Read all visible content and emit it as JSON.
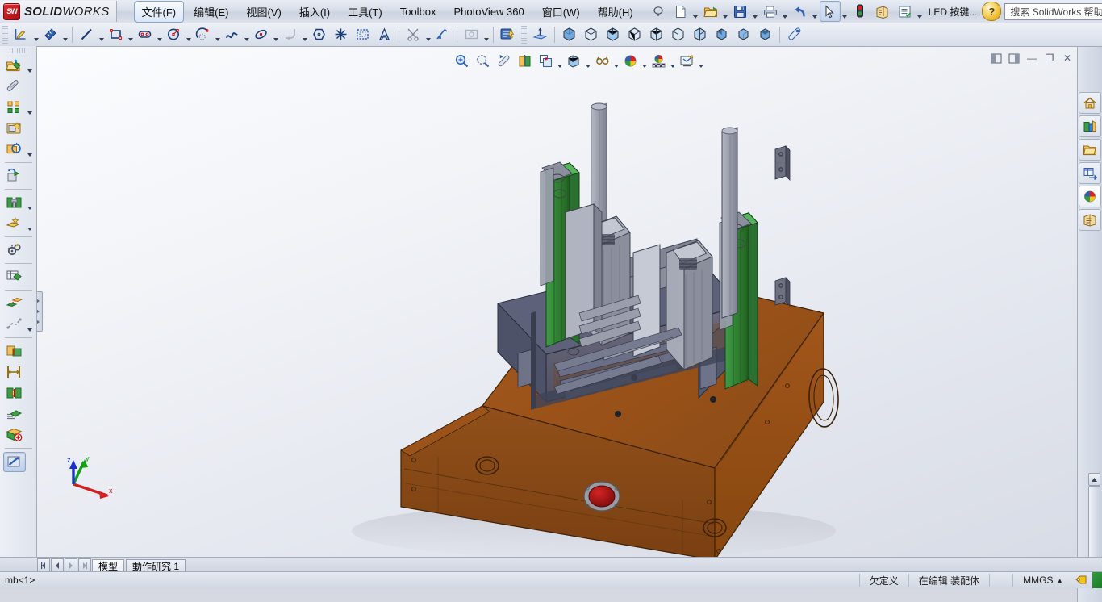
{
  "app": {
    "brand_s": "S",
    "brand_w": "W",
    "name_bold": "SOLID",
    "name_light": "WORKS"
  },
  "menu": {
    "items": [
      {
        "label": "文件(F)",
        "name": "menu-file",
        "active": true
      },
      {
        "label": "编辑(E)",
        "name": "menu-edit",
        "active": false
      },
      {
        "label": "视图(V)",
        "name": "menu-view",
        "active": false
      },
      {
        "label": "插入(I)",
        "name": "menu-insert",
        "active": false
      },
      {
        "label": "工具(T)",
        "name": "menu-tools",
        "active": false
      },
      {
        "label": "Toolbox",
        "name": "menu-toolbox",
        "active": false
      },
      {
        "label": "PhotoView 360",
        "name": "menu-photoview",
        "active": false
      },
      {
        "label": "窗口(W)",
        "name": "menu-window",
        "active": false
      },
      {
        "label": "帮助(H)",
        "name": "menu-help",
        "active": false
      }
    ]
  },
  "quick_toolbar": {
    "new_doc": "new-document",
    "open_doc": "open-document",
    "save": "save",
    "print": "print",
    "undo": "undo",
    "select": "select-arrow",
    "rebuild": "rebuild-traffic-light",
    "options": "options",
    "properties": "document-properties",
    "led_label": "LED 按键..."
  },
  "search": {
    "placeholder": "搜索 SolidWorks 帮助",
    "icon": "search-icon",
    "help_icon": "help-icon"
  },
  "window_controls": {
    "minimize": "—",
    "restore": "❐",
    "close": "✕",
    "help_caret": "?"
  },
  "sketch_toolbar": {
    "tools": [
      {
        "name": "sketch-tool",
        "caret": true
      },
      {
        "name": "smart-dimension-tool",
        "caret": true
      },
      {
        "name": "line-tool",
        "caret": true
      },
      {
        "name": "rectangle-tool",
        "caret": true
      },
      {
        "name": "slot-tool",
        "caret": true
      },
      {
        "name": "circle-tool",
        "caret": true
      },
      {
        "name": "arc-tool",
        "caret": true
      },
      {
        "name": "spline-tool",
        "caret": true
      },
      {
        "name": "ellipse-tool",
        "caret": true
      },
      {
        "name": "fillet-tool",
        "caret": true
      },
      {
        "name": "polygon-tool",
        "caret": false
      },
      {
        "name": "point-tool",
        "caret": false
      },
      {
        "name": "construction-geometry-tool",
        "caret": false
      },
      {
        "name": "text-tool",
        "caret": false
      },
      {
        "name": "trim-entities-tool",
        "caret": true
      },
      {
        "name": "offset-entities-tool",
        "caret": true
      },
      {
        "name": "mirror-entities-tool",
        "caret": false
      },
      {
        "name": "convert-entities-tool",
        "caret": false
      },
      {
        "name": "linear-pattern-tool",
        "caret": false
      },
      {
        "name": "pattern-tool",
        "caret": true
      },
      {
        "name": "move-entities-tool",
        "caret": true
      },
      {
        "name": "display-delete-relations-tool",
        "caret": true
      },
      {
        "name": "repair-sketch-tool",
        "caret": false
      },
      {
        "name": "quick-snaps-tool",
        "caret": true
      },
      {
        "name": "rapid-sketch-tool",
        "caret": false
      }
    ],
    "view_orientations": [
      {
        "name": "reference-geometry-plane"
      },
      {
        "name": "view-isometric"
      },
      {
        "name": "view-trimetric"
      },
      {
        "name": "view-dimetric"
      },
      {
        "name": "view-front"
      },
      {
        "name": "view-back"
      },
      {
        "name": "view-left"
      },
      {
        "name": "view-right"
      },
      {
        "name": "view-top"
      },
      {
        "name": "view-bottom"
      },
      {
        "name": "view-normal-to"
      },
      {
        "name": "measure-tool"
      }
    ]
  },
  "assembly_toolbar": {
    "items": [
      {
        "name": "insert-components",
        "caret": true
      },
      {
        "name": "mate",
        "caret": false
      },
      {
        "name": "linear-component-pattern",
        "caret": true
      },
      {
        "name": "smart-fasteners",
        "caret": false
      },
      {
        "name": "move-component",
        "caret": true
      },
      {
        "name": "show-hidden-components",
        "caret": false
      },
      {
        "name": "assembly-features",
        "caret": true
      },
      {
        "name": "reference-geometry",
        "caret": true
      },
      {
        "name": "new-motion-study",
        "caret": false
      },
      {
        "name": "bill-of-materials",
        "caret": false
      },
      {
        "name": "exploded-view",
        "caret": false
      },
      {
        "name": "explode-line-sketch",
        "caret": false
      },
      {
        "name": "interference-detection",
        "caret": true
      },
      {
        "name": "clearance-verification",
        "caret": false
      },
      {
        "name": "hole-alignment",
        "caret": false
      },
      {
        "name": "assembly-visualization",
        "caret": false
      },
      {
        "name": "performance-evaluation",
        "caret": false
      },
      {
        "name": "large-assembly-mode",
        "caret": false
      },
      {
        "name": "section-view-tool",
        "caret": false
      }
    ]
  },
  "heads_up_view": {
    "items": [
      {
        "name": "zoom-to-fit-icon",
        "caret": false
      },
      {
        "name": "zoom-to-area-icon",
        "caret": false
      },
      {
        "name": "previous-view-icon",
        "caret": false
      },
      {
        "name": "section-view-icon",
        "caret": false
      },
      {
        "name": "view-orientation-icon",
        "caret": true
      },
      {
        "name": "display-style-icon",
        "caret": true
      },
      {
        "name": "hide-show-items-icon",
        "caret": true
      },
      {
        "name": "edit-appearance-icon",
        "caret": true
      },
      {
        "name": "apply-scene-icon",
        "caret": true
      },
      {
        "name": "view-settings-icon",
        "caret": true
      }
    ]
  },
  "document_window_controls": {
    "items": [
      {
        "name": "split-vertical-icon",
        "glyph": "◧"
      },
      {
        "name": "split-horizontal-icon",
        "glyph": "◨"
      },
      {
        "name": "doc-minimize-icon",
        "glyph": "—"
      },
      {
        "name": "doc-restore-icon",
        "glyph": "❐"
      },
      {
        "name": "doc-close-icon",
        "glyph": "✕"
      }
    ]
  },
  "task_pane": {
    "items": [
      {
        "name": "task-pane-resources-icon",
        "selected": false
      },
      {
        "name": "task-pane-design-library-icon",
        "selected": false
      },
      {
        "name": "task-pane-file-explorer-icon",
        "selected": false
      },
      {
        "name": "task-pane-view-palette-icon",
        "selected": false
      },
      {
        "name": "task-pane-appearances-icon",
        "selected": true
      },
      {
        "name": "task-pane-custom-properties-icon",
        "selected": false
      }
    ]
  },
  "triad": {
    "x_label": "x",
    "y_label": "y",
    "z_label": "z",
    "x_color": "#d61d1d",
    "y_color": "#15a015",
    "z_color": "#1a33cc"
  },
  "bottom_tabs": {
    "nav": [
      "⏮",
      "◀",
      "▶",
      "⏭"
    ],
    "tabs": [
      {
        "label": "模型",
        "name": "tab-model",
        "active": true
      },
      {
        "label": "動作研究 1",
        "name": "tab-motion-study-1",
        "active": false
      }
    ]
  },
  "status_bar": {
    "left_text": "mb<1>",
    "cells": [
      {
        "label": "欠定义",
        "name": "status-underdefined"
      },
      {
        "label": "在编辑 装配体",
        "name": "status-editing-assembly"
      },
      {
        "label": "",
        "name": "status-spacer"
      },
      {
        "label": "MMGS",
        "name": "status-units"
      }
    ],
    "units_caret": "▴"
  },
  "model": {
    "description": "3D assembly: brown sheet-metal base cabinet with red indicator lamp, blue-gray translucent enclosure, gray mast frame, green linear guide rails",
    "colors": {
      "base_brown": "#8a4a16",
      "base_brown_light": "#a85a1c",
      "base_brown_dark": "#6d3a10",
      "mast_gray": "#8b8f9c",
      "mast_gray_light": "#b4b8c4",
      "mast_gray_dark": "#6d7180",
      "rail_green": "#2f7d36",
      "rail_green_light": "#3f9c46",
      "enclosure_blue": "#5b5f78",
      "lamp_red": "#9e1212",
      "lamp_ring": "#9a9aa2"
    }
  }
}
